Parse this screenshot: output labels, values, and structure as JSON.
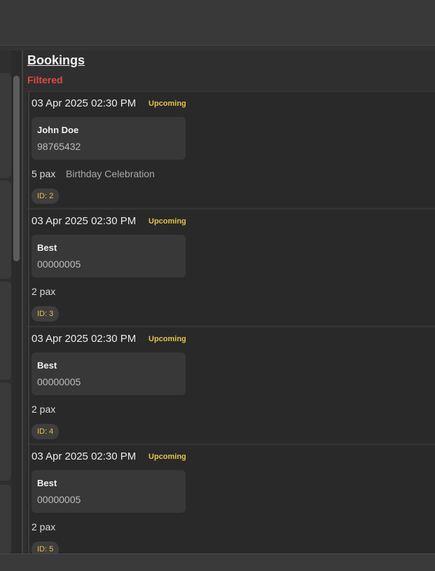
{
  "bookings_panel": {
    "title": "Bookings",
    "filter_label": "Filtered",
    "cards": [
      {
        "datetime": "03 Apr 2025 02:30 PM",
        "status": "Upcoming",
        "customer_name": "John Doe",
        "phone": "98765432",
        "pax": "5 pax",
        "occasion": "Birthday Celebration",
        "id": "ID: 2"
      },
      {
        "datetime": "03 Apr 2025 02:30 PM",
        "status": "Upcoming",
        "customer_name": "Best",
        "phone": "00000005",
        "pax": "2 pax",
        "occasion": "",
        "id": "ID: 3"
      },
      {
        "datetime": "03 Apr 2025 02:30 PM",
        "status": "Upcoming",
        "customer_name": "Best",
        "phone": "00000005",
        "pax": "2 pax",
        "occasion": "",
        "id": "ID: 4"
      },
      {
        "datetime": "03 Apr 2025 02:30 PM",
        "status": "Upcoming",
        "customer_name": "Best",
        "phone": "00000005",
        "pax": "2 pax",
        "occasion": "",
        "id": "ID: 5"
      }
    ]
  },
  "colors": {
    "background": "#2b2b2b",
    "card": "#292929",
    "status_accent": "#e7c248",
    "filter_accent": "#e0484a"
  }
}
